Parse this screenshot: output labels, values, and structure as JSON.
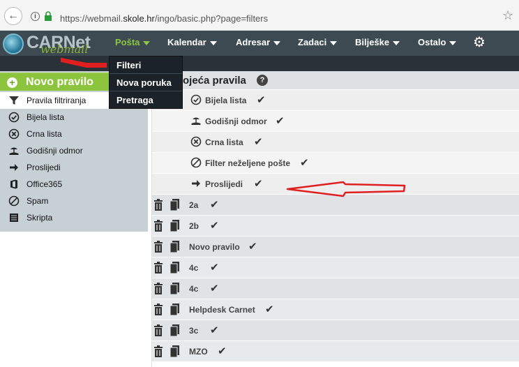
{
  "browser": {
    "url_prefix": "https://webmail.",
    "url_domain": "skole.hr",
    "url_suffix": "/ingo/basic.php?page=filters"
  },
  "logo": {
    "main": "CARNet",
    "sub": "webmail"
  },
  "nav": {
    "items": [
      {
        "label": "Pošta",
        "active": true
      },
      {
        "label": "Kalendar"
      },
      {
        "label": "Adresar"
      },
      {
        "label": "Zadaci"
      },
      {
        "label": "Bilješke"
      },
      {
        "label": "Ostalo"
      }
    ],
    "settings_icon": "gear-icon"
  },
  "dropdown": {
    "items": [
      "Filteri",
      "Nova poruka",
      "Pretraga"
    ]
  },
  "sidebar": {
    "new_rule": "Novo pravilo",
    "items": [
      {
        "label": "Pravila filtriranja",
        "icon": "filter-icon",
        "active": true
      },
      {
        "label": "Bijela lista",
        "icon": "check-circle-icon"
      },
      {
        "label": "Crna lista",
        "icon": "x-circle-icon"
      },
      {
        "label": "Godišnji odmor",
        "icon": "vacation-icon"
      },
      {
        "label": "Proslijedi",
        "icon": "arrow-right-icon"
      },
      {
        "label": "Office365",
        "icon": "office-icon"
      },
      {
        "label": "Spam",
        "icon": "spam-icon"
      },
      {
        "label": "Skripta",
        "icon": "script-icon"
      }
    ]
  },
  "main": {
    "title": "ojeća pravila",
    "system_rules": [
      {
        "name": "Bijela lista",
        "icon": "check-circle-icon"
      },
      {
        "name": "Godišnji odmor",
        "icon": "vacation-icon"
      },
      {
        "name": "Crna lista",
        "icon": "x-circle-icon"
      },
      {
        "name": "Filter neželjene pošte",
        "icon": "spam-icon"
      },
      {
        "name": "Proslijedi",
        "icon": "arrow-right-icon"
      }
    ],
    "user_rules": [
      {
        "name": "2a"
      },
      {
        "name": "2b"
      },
      {
        "name": "Novo pravilo"
      },
      {
        "name": "4c"
      },
      {
        "name": "4c"
      },
      {
        "name": "Helpdesk Carnet"
      },
      {
        "name": "3c"
      },
      {
        "name": "MZO"
      }
    ]
  },
  "colors": {
    "nav_bg": "#3d4a52",
    "accent_green": "#8dc43e",
    "annotation_red": "#e02020"
  }
}
